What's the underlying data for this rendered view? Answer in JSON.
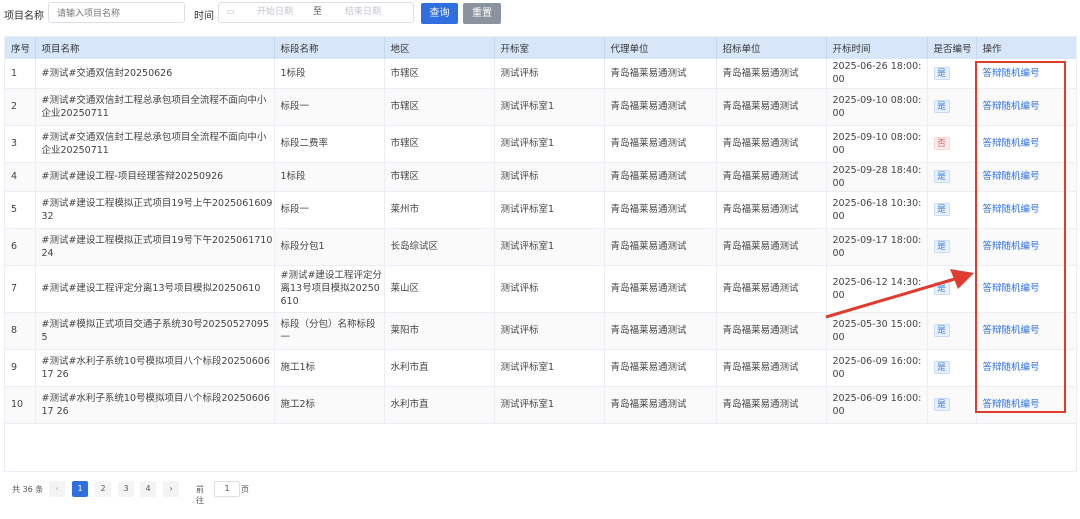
{
  "filter": {
    "name_label": "项目名称",
    "name_placeholder": "请输入项目名称",
    "time_label": "时间",
    "start_placeholder": "开始日期",
    "sep": "至",
    "end_placeholder": "结束日期",
    "search_btn": "查询",
    "reset_btn": "重置",
    "search_color": "#2f6fe0",
    "reset_color": "#8b939e"
  },
  "table": {
    "headers": [
      "序号",
      "项目名称",
      "标段名称",
      "地区",
      "开标室",
      "代理单位",
      "招标单位",
      "开标时间",
      "是否编号",
      "操作"
    ],
    "rows": [
      {
        "no": "1",
        "project": "#测试#交通双信封20250626",
        "section": "1标段",
        "region": "市辖区",
        "room": "测试评标",
        "agency": "青岛福莱易通测试",
        "tenderer": "青岛福莱易通测试",
        "time": "2025-06-26 18:00:00",
        "numbered": "是",
        "action": "答辩随机编号"
      },
      {
        "no": "2",
        "project": "#测试#交通双信封工程总承包项目全流程不面向中小企业20250711",
        "section": "标段一",
        "region": "市辖区",
        "room": "测试评标室1",
        "agency": "青岛福莱易通测试",
        "tenderer": "青岛福莱易通测试",
        "time": "2025-09-10 08:00:00",
        "numbered": "是",
        "action": "答辩随机编号"
      },
      {
        "no": "3",
        "project": "#测试#交通双信封工程总承包项目全流程不面向中小企业20250711",
        "section": "标段二费率",
        "region": "市辖区",
        "room": "测试评标室1",
        "agency": "青岛福莱易通测试",
        "tenderer": "青岛福莱易通测试",
        "time": "2025-09-10 08:00:00",
        "numbered": "否",
        "action": "答辩随机编号"
      },
      {
        "no": "4",
        "project": "#测试#建设工程-项目经理答辩20250926",
        "section": "1标段",
        "region": "市辖区",
        "room": "测试评标",
        "agency": "青岛福莱易通测试",
        "tenderer": "青岛福莱易通测试",
        "time": "2025-09-28 18:40:00",
        "numbered": "是",
        "action": "答辩随机编号"
      },
      {
        "no": "5",
        "project": "#测试#建设工程模拟正式项目19号上午202506160932",
        "section": "标段一",
        "region": "莱州市",
        "room": "测试评标室1",
        "agency": "青岛福莱易通测试",
        "tenderer": "青岛福莱易通测试",
        "time": "2025-06-18 10:30:00",
        "numbered": "是",
        "action": "答辩随机编号"
      },
      {
        "no": "6",
        "project": "#测试#建设工程模拟正式项目19号下午202506171024",
        "section": "标段分包1",
        "region": "长岛综试区",
        "room": "测试评标室1",
        "agency": "青岛福莱易通测试",
        "tenderer": "青岛福莱易通测试",
        "time": "2025-09-17 18:00:00",
        "numbered": "是",
        "action": "答辩随机编号"
      },
      {
        "no": "7",
        "project": "#测试#建设工程评定分离13号项目模拟20250610",
        "section": "#测试#建设工程评定分离13号项目模拟20250610",
        "region": "莱山区",
        "room": "测试评标",
        "agency": "青岛福莱易通测试",
        "tenderer": "青岛福莱易通测试",
        "time": "2025-06-12 14:30:00",
        "numbered": "是",
        "action": "答辩随机编号"
      },
      {
        "no": "8",
        "project": "#测试#模拟正式项目交通子系统30号202505270955",
        "section": "标段（分包）名称标段一",
        "region": "莱阳市",
        "room": "测试评标",
        "agency": "青岛福莱易通测试",
        "tenderer": "青岛福莱易通测试",
        "time": "2025-05-30 15:00:00",
        "numbered": "是",
        "action": "答辩随机编号"
      },
      {
        "no": "9",
        "project": "#测试#水利子系统10号模拟项目八个标段2025060617 26",
        "section": "施工1标",
        "region": "水利市直",
        "room": "测试评标室1",
        "agency": "青岛福莱易通测试",
        "tenderer": "青岛福莱易通测试",
        "time": "2025-06-09 16:00:00",
        "numbered": "是",
        "action": "答辩随机编号"
      },
      {
        "no": "10",
        "project": "#测试#水利子系统10号模拟项目八个标段2025060617 26",
        "section": "施工2标",
        "region": "水利市直",
        "room": "测试评标室1",
        "agency": "青岛福莱易通测试",
        "tenderer": "青岛福莱易通测试",
        "time": "2025-06-09 16:00:00",
        "numbered": "是",
        "action": "答辩随机编号"
      }
    ]
  },
  "pager": {
    "total": "共 36 条",
    "prev": "‹",
    "pages": [
      "1",
      "2",
      "3",
      "4"
    ],
    "next": "›",
    "goto": "前往",
    "page_value": "1",
    "page_unit": "页"
  }
}
